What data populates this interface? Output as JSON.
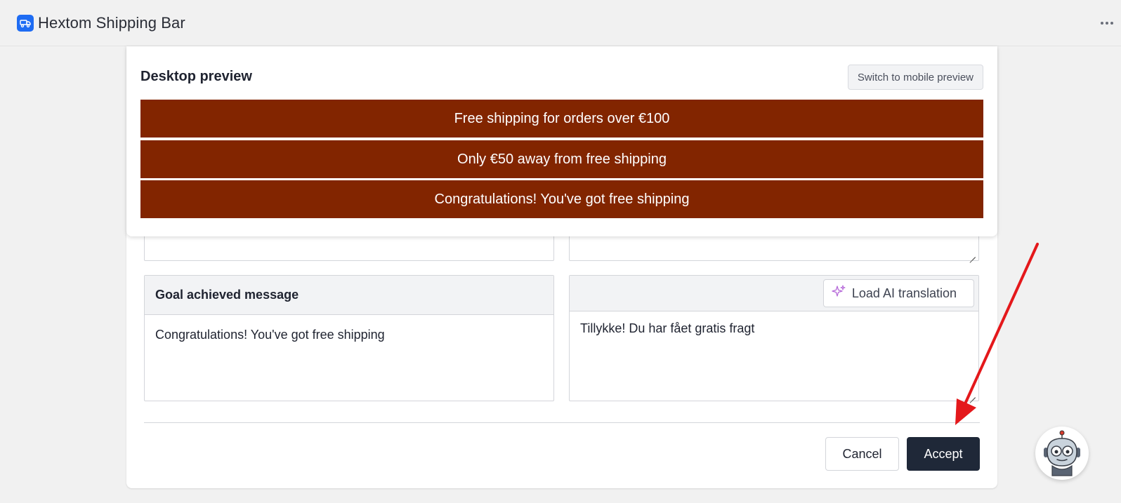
{
  "app": {
    "title": "Hextom Shipping Bar",
    "icon": "truck-icon",
    "brand_color": "#1e6cf3"
  },
  "preview": {
    "title": "Desktop preview",
    "switch_label": "Switch to mobile preview",
    "bar_color": "#822500",
    "bars": [
      "Free shipping for orders over €100",
      "Only €50 away from free shipping",
      "Congratulations! You've got free shipping"
    ]
  },
  "form": {
    "goal_label": "Goal achieved message",
    "goal_value": "Congratulations! You've got free shipping",
    "ai_button_label": "Load AI translation",
    "ai_icon": "sparkle-icon",
    "translation_value": "Tillykke! Du har fået gratis fragt"
  },
  "actions": {
    "cancel_label": "Cancel",
    "accept_label": "Accept",
    "accept_color": "#1f2838"
  },
  "annotation": {
    "arrow_color": "#e4181b"
  },
  "chat": {
    "icon": "robot-chat-icon"
  }
}
